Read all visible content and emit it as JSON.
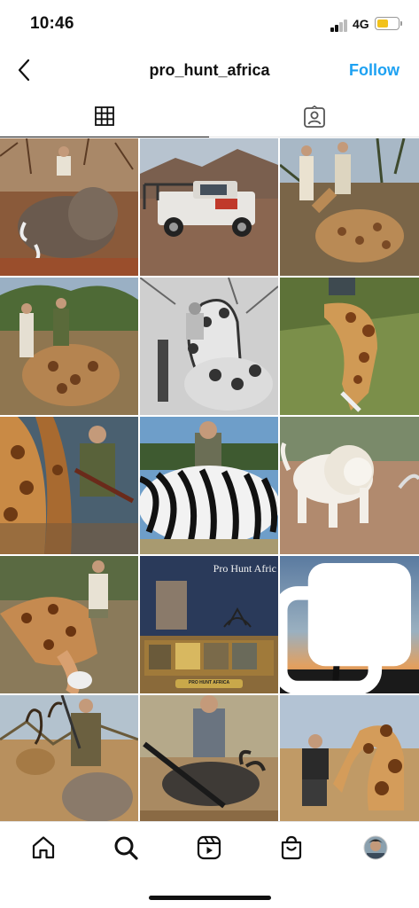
{
  "status_bar": {
    "time": "10:46",
    "network": "4G"
  },
  "header": {
    "username": "pro_hunt_africa",
    "follow_label": "Follow"
  },
  "tabs": [
    {
      "icon": "grid-icon",
      "active": true
    },
    {
      "icon": "tagged-icon",
      "active": false
    }
  ],
  "posts": [
    {
      "subject": "elephant"
    },
    {
      "subject": "truck"
    },
    {
      "subject": "giraffe"
    },
    {
      "subject": "giraffe"
    },
    {
      "subject": "giraffe-bw"
    },
    {
      "subject": "giraffe"
    },
    {
      "subject": "giraffe"
    },
    {
      "subject": "zebra"
    },
    {
      "subject": "white-lion"
    },
    {
      "subject": "giraffe"
    },
    {
      "subject": "pro-hunt-africa-banner"
    },
    {
      "subject": "sunset-tree",
      "multiple": true
    },
    {
      "subject": "kudu"
    },
    {
      "subject": "wildebeest"
    },
    {
      "subject": "giraffe"
    }
  ],
  "banner": {
    "title": "Pro Hunt Afric",
    "button": "PRO HUNT AFRICA"
  },
  "bottom_nav": [
    "home-icon",
    "search-icon",
    "reels-icon",
    "shop-icon",
    "profile-avatar"
  ],
  "colors": {
    "follow": "#1da1f2",
    "battery": "#f2c21b"
  }
}
